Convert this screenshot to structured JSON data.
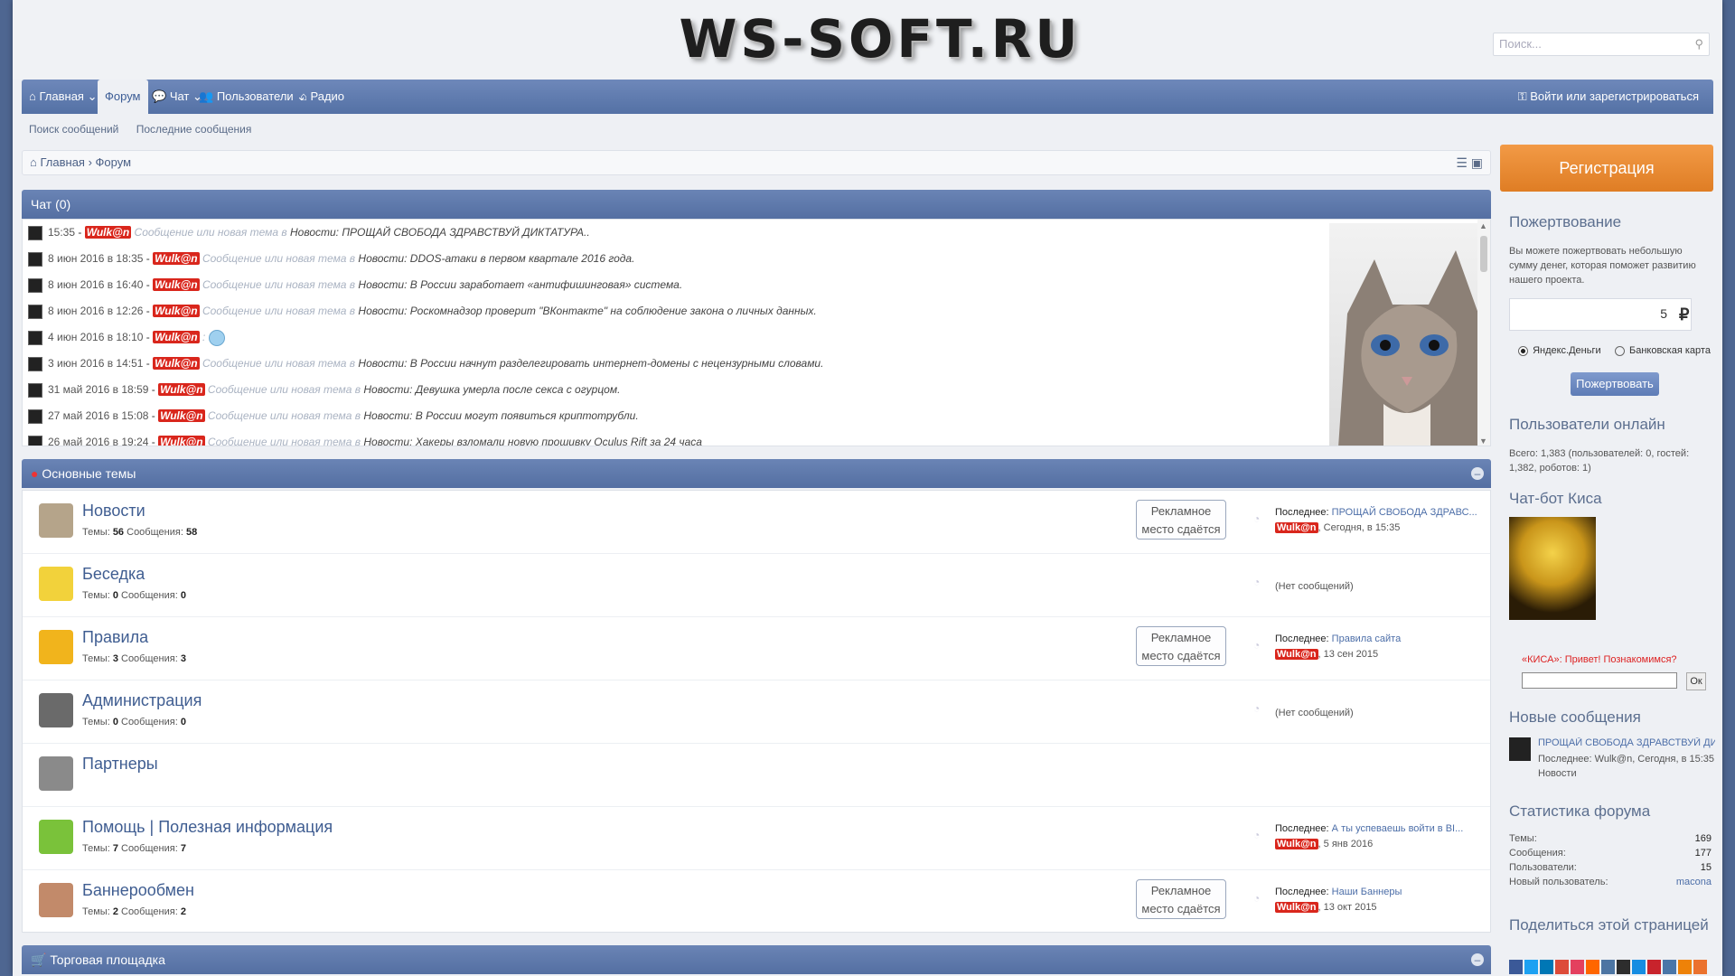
{
  "header": {
    "logo": "WS-SOFT.RU",
    "search_placeholder": "Поиск..."
  },
  "nav": {
    "items": [
      {
        "label": "Главная",
        "icon": "home-icon",
        "dropdown": true
      },
      {
        "label": "Форум",
        "active": true
      },
      {
        "label": "Чат",
        "icon": "chat-icon",
        "dropdown": true
      },
      {
        "label": "Пользователи",
        "icon": "users-icon",
        "dropdown": true
      },
      {
        "label": "Радио",
        "icon": "home-icon"
      }
    ],
    "login": "Войти или зарегистрироваться"
  },
  "subnav": [
    "Поиск сообщений",
    "Последние сообщения"
  ],
  "breadcrumb": [
    "Главная",
    "Форум"
  ],
  "chat": {
    "title": "Чат (0)",
    "rows": [
      {
        "time": "15:35",
        "user": "Wulk@n",
        "verb": "Сообщение или новая тема в",
        "msg": "Новости: ПРОЩАЙ СВОБОДА ЗДРАВСТВУЙ ДИКТАТУРА.."
      },
      {
        "time": "8 июн 2016 в 18:35",
        "user": "Wulk@n",
        "verb": "Сообщение или новая тема в",
        "msg": "Новости: DDOS-атаки в первом квартале 2016 года."
      },
      {
        "time": "8 июн 2016 в 16:40",
        "user": "Wulk@n",
        "verb": "Сообщение или новая тема в",
        "msg": "Новости: В России заработает «антифишинговая» система."
      },
      {
        "time": "8 июн 2016 в 12:26",
        "user": "Wulk@n",
        "verb": "Сообщение или новая тема в",
        "msg": "Новости: Роскомнадзор проверит \"ВКонтакте\" на соблюдение закона о личных данных."
      },
      {
        "time": "4 июн 2016 в 18:10",
        "user": "Wulk@n",
        "verb": ":",
        "msg": ""
      },
      {
        "time": "3 июн 2016 в 14:51",
        "user": "Wulk@n",
        "verb": "Сообщение или новая тема в",
        "msg": "Новости: В России начнут разделегировать интернет-домены с нецензурными словами."
      },
      {
        "time": "31 май 2016 в 18:59",
        "user": "Wulk@n",
        "verb": "Сообщение или новая тема в",
        "msg": "Новости: Девушка умерла после секса с огурцом."
      },
      {
        "time": "27 май 2016 в 15:08",
        "user": "Wulk@n",
        "verb": "Сообщение или новая тема в",
        "msg": "Новости: В России могут появиться криптотрубли."
      },
      {
        "time": "26 май 2016 в 19:24",
        "user": "Wulk@n",
        "verb": "Сообщение или новая тема в",
        "msg": "Новости: Хакеры взломали новую прошивку Oculus Rift за 24 часа"
      }
    ]
  },
  "main_topics": {
    "title": "Основные темы",
    "forums": [
      {
        "title": "Новости",
        "stats_label_topics": "Темы:",
        "topics": "56",
        "stats_label_posts": "Сообщения:",
        "posts": "58",
        "ad": "Рекламное место сдаётся",
        "last_label": "Последнее:",
        "last_title": "ПРОЩАЙ СВОБОДА ЗДРАВС...",
        "last_user": "Wulk@n",
        "last_when": ", Сегодня, в 15:35",
        "icon_color": "#b5a48a"
      },
      {
        "title": "Беседка",
        "stats_label_topics": "Темы:",
        "topics": "0",
        "stats_label_posts": "Сообщения:",
        "posts": "0",
        "ad": "",
        "no_posts": "(Нет сообщений)",
        "icon_color": "#f2d23b"
      },
      {
        "title": "Правила",
        "stats_label_topics": "Темы:",
        "topics": "3",
        "stats_label_posts": "Сообщения:",
        "posts": "3",
        "ad": "Рекламное место сдаётся",
        "last_label": "Последнее:",
        "last_title": "Правила сайта",
        "last_user": "Wulk@n",
        "last_when": ", 13 сен 2015",
        "icon_color": "#f1b41c"
      },
      {
        "title": "Администрация",
        "stats_label_topics": "Темы:",
        "topics": "0",
        "stats_label_posts": "Сообщения:",
        "posts": "0",
        "ad": "",
        "no_posts": "(Нет сообщений)",
        "icon_color": "#6a6a6a"
      },
      {
        "title": "Партнеры",
        "icon_color": "#8a8a8a"
      },
      {
        "title": "Помощь | Полезная информация",
        "stats_label_topics": "Темы:",
        "topics": "7",
        "stats_label_posts": "Сообщения:",
        "posts": "7",
        "ad": "",
        "last_label": "Последнее:",
        "last_title": "А ты успеваешь войти в BI...",
        "last_user": "Wulk@n",
        "last_when": ", 5 янв 2016",
        "icon_color": "#7ac23a"
      },
      {
        "title": "Баннерообмен",
        "stats_label_topics": "Темы:",
        "topics": "2",
        "stats_label_posts": "Сообщения:",
        "posts": "2",
        "ad": "Рекламное место сдаётся",
        "last_label": "Последнее:",
        "last_title": "Наши Баннеры",
        "last_user": "Wulk@n",
        "last_when": ", 13 окт 2015",
        "icon_color": "#c28a6a"
      }
    ]
  },
  "trade": {
    "title": "Торговая площадка"
  },
  "sidebar": {
    "register": "Регистрация",
    "donation": {
      "title": "Пожертвование",
      "text": "Вы можете пожертвовать небольшую сумму денег, которая поможет развитию нашего проекта.",
      "amount": "5",
      "currency": "₽",
      "option1": "Яндекс.Деньги",
      "option2": "Банковская карта",
      "button": "Пожертвовать"
    },
    "online": {
      "title": "Пользователи онлайн",
      "text": "Всего: 1,383 (пользователей: 0, гостей: 1,382, роботов: 1)"
    },
    "bot": {
      "title": "Чат-бот Киса",
      "greeting": "«КИСА»: Привет! Познакомимся?",
      "ok": "Ок"
    },
    "new_posts": {
      "title": "Новые сообщения",
      "link": "ПРОЩАЙ СВОБОДА ЗДРАВСТВУЙ ДИК...",
      "meta": "Последнее: Wulk@n, Сегодня, в 15:35",
      "forum": "Новости"
    },
    "stats": {
      "title": "Статистика форума",
      "rows": [
        {
          "label": "Темы:",
          "value": "169"
        },
        {
          "label": "Сообщения:",
          "value": "177"
        },
        {
          "label": "Пользователи:",
          "value": "15"
        },
        {
          "label": "Новый пользователь:",
          "value": "macona"
        }
      ]
    },
    "share": {
      "title": "Поделиться этой страницей",
      "colors": [
        "#3b5998",
        "#1da1f2",
        "#0077b5",
        "#dd4b39",
        "#e4405f",
        "#ff6600",
        "#4c75a3",
        "#2d2d2d",
        "#168de2",
        "#c8232c",
        "#4a76a8",
        "#ee8208",
        "#eb722e",
        "#1da1f2",
        "#3b5998"
      ]
    }
  }
}
